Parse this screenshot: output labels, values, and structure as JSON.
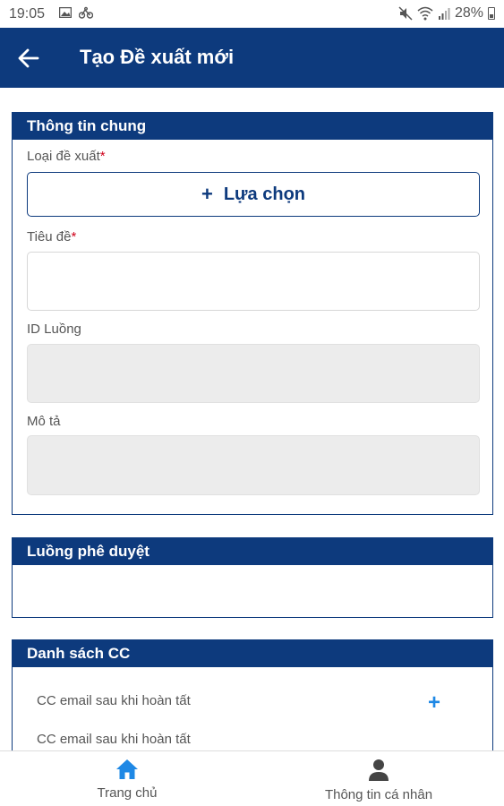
{
  "status_bar": {
    "time": "19:05",
    "battery": "28%",
    "icons": [
      "image-icon",
      "bike-icon",
      "mute-icon",
      "wifi-icon",
      "signal-icon",
      "battery-icon"
    ]
  },
  "app_bar": {
    "title": "Tạo Đề xuất mới",
    "back_icon": "arrow-left-icon"
  },
  "general_info": {
    "header": "Thông tin chung",
    "proposal_type_label": "Loại đề xuất",
    "required_mark": "*",
    "select_button_plus": "+",
    "select_button_label": "Lựa chọn",
    "title_label": "Tiêu đề",
    "title_value": "",
    "flow_id_label": "ID Luồng",
    "flow_id_value": "",
    "description_label": "Mô tả",
    "description_value": ""
  },
  "approval_flow": {
    "header": "Luồng phê duyệt"
  },
  "cc_list": {
    "header": "Danh sách CC",
    "rows": [
      {
        "label": "CC email sau khi hoàn tất"
      },
      {
        "label": "CC email sau khi hoàn tất"
      }
    ],
    "add_icon": "+"
  },
  "bottom_nav": {
    "items": [
      {
        "label": "Trang chủ",
        "icon": "home-icon",
        "active": true
      },
      {
        "label": "Thông tin cá nhân",
        "icon": "person-icon",
        "active": false
      }
    ]
  },
  "colors": {
    "primary": "#0d3a7d",
    "accent_blue": "#1e88e5",
    "required": "#d0021b",
    "disabled_field": "#ececec"
  }
}
